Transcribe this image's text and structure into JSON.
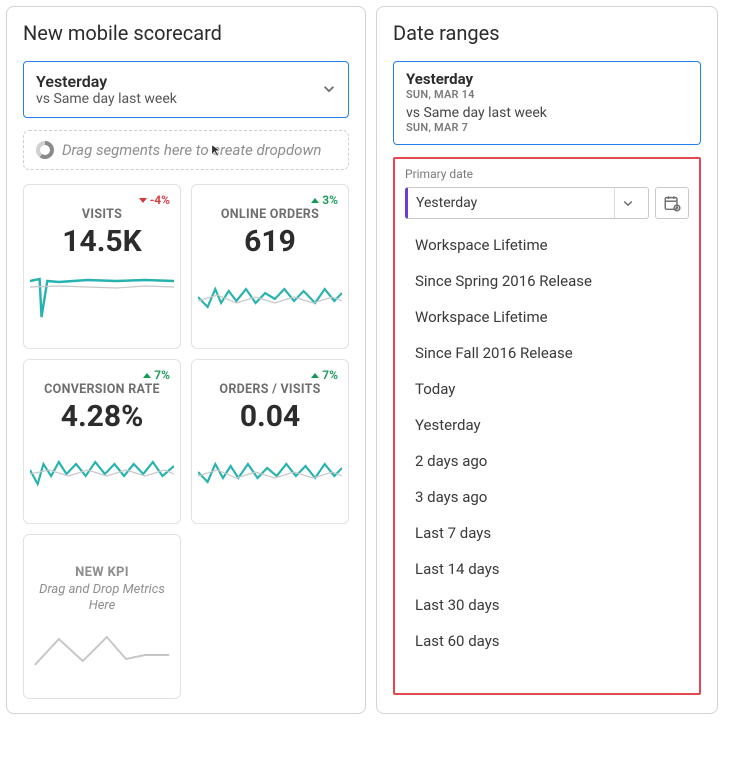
{
  "scorecard": {
    "title": "New mobile scorecard",
    "dateSelector": {
      "main": "Yesterday",
      "sub": "vs Same day last week"
    },
    "dropHint": "Drag segments here to create dropdown",
    "cards": [
      {
        "label": "VISITS",
        "value": "14.5K",
        "delta": "-4%",
        "dir": "down"
      },
      {
        "label": "ONLINE ORDERS",
        "value": "619",
        "delta": "3%",
        "dir": "up"
      },
      {
        "label": "CONVERSION RATE",
        "value": "4.28%",
        "delta": "7%",
        "dir": "up"
      },
      {
        "label": "ORDERS / VISITS",
        "value": "0.04",
        "delta": "7%",
        "dir": "up"
      }
    ],
    "newKpi": {
      "label": "NEW KPI",
      "hint": "Drag and Drop Metrics Here"
    }
  },
  "dateRanges": {
    "title": "Date ranges",
    "summary": {
      "line1": "Yesterday",
      "line2": "SUN, MAR 14",
      "line3": "vs Same day last week",
      "line4": "SUN, MAR 7"
    },
    "primaryLabel": "Primary date",
    "primarySelected": "Yesterday",
    "options": [
      "Workspace Lifetime",
      "Since Spring 2016 Release",
      "Workspace Lifetime",
      "Since Fall 2016 Release",
      "Today",
      "Yesterday",
      "2 days ago",
      "3 days ago",
      "Last 7 days",
      "Last 14 days",
      "Last 30 days",
      "Last 60 days"
    ]
  },
  "colors": {
    "accent": "#2680eb",
    "teal": "#26b3b0",
    "grey": "#b8b8b8"
  }
}
